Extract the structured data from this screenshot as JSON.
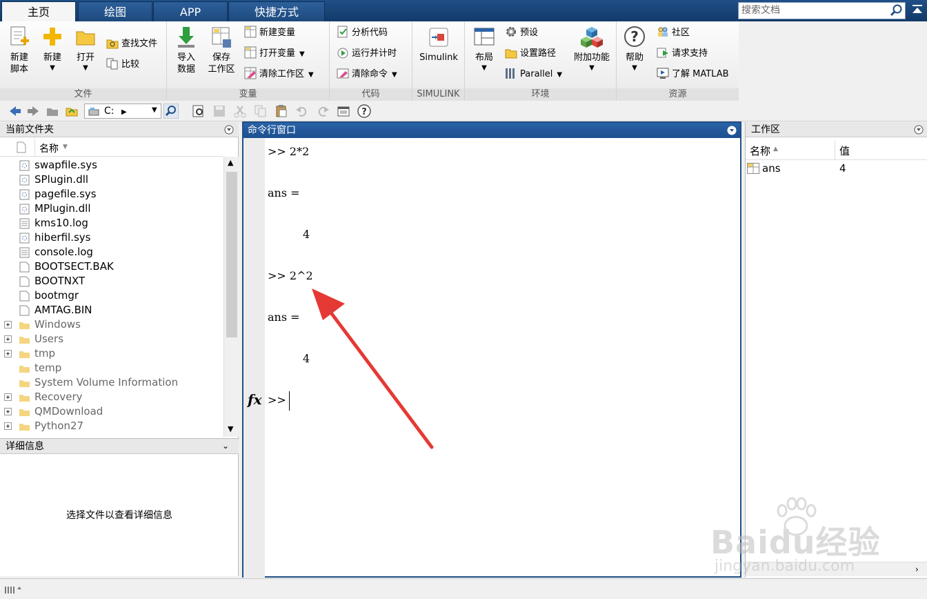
{
  "tabs": [
    "主页",
    "绘图",
    "APP",
    "快捷方式"
  ],
  "search": {
    "placeholder": "搜索文档"
  },
  "ribbon": {
    "file": {
      "label": "文件",
      "new_script": [
        "新建",
        "脚本"
      ],
      "new": "新建",
      "open": "打开",
      "find_files": "查找文件",
      "compare": "比较"
    },
    "variable": {
      "label": "变量",
      "import_data": [
        "导入",
        "数据"
      ],
      "save_workspace": [
        "保存",
        "工作区"
      ],
      "new_variable": "新建变量",
      "open_variable": "打开变量",
      "clear_workspace": "清除工作区"
    },
    "code": {
      "label": "代码",
      "analyze_code": "分析代码",
      "run_and_time": "运行并计时",
      "clear_commands": "清除命令"
    },
    "simulink": {
      "label": "SIMULINK",
      "simulink": "Simulink"
    },
    "environment": {
      "label": "环境",
      "layout": "布局",
      "preferences": "预设",
      "set_path": "设置路径",
      "parallel": "Parallel",
      "add_ons": "附加功能"
    },
    "resources": {
      "label": "资源",
      "help": "帮助",
      "community": "社区",
      "request_support": "请求支持",
      "learn_matlab": "了解 MATLAB"
    }
  },
  "toolbar": {
    "path": "C:"
  },
  "current_folder": {
    "title": "当前文件夹",
    "column_name": "名称",
    "files": [
      "swapfile.sys",
      "SPlugin.dll",
      "pagefile.sys",
      "MPlugin.dll",
      "kms10.log",
      "hiberfil.sys",
      "console.log",
      "BOOTSECT.BAK",
      "BOOTNXT",
      "bootmgr",
      "AMTAG.BIN"
    ],
    "folders": [
      "Windows",
      "Users",
      "tmp",
      "temp",
      "System Volume Information",
      "Recovery",
      "QMDownload",
      "Python27"
    ]
  },
  "details": {
    "title": "详细信息",
    "message": "选择文件以查看详细信息"
  },
  "command_window": {
    "title": "命令行窗口",
    "lines": [
      ">> 2*2",
      "ans =",
      "4",
      ">> 2^2",
      "ans =",
      "4"
    ],
    "prompt": ">>"
  },
  "workspace": {
    "title": "工作区",
    "col_name": "名称",
    "col_value": "值",
    "vars": [
      {
        "name": "ans",
        "value": "4"
      }
    ]
  },
  "watermark": {
    "line1": "Baidu经验",
    "line2": "jingyan.baidu.com"
  },
  "colors": {
    "accent": "#1f4f86",
    "arrow": "#e53935"
  }
}
